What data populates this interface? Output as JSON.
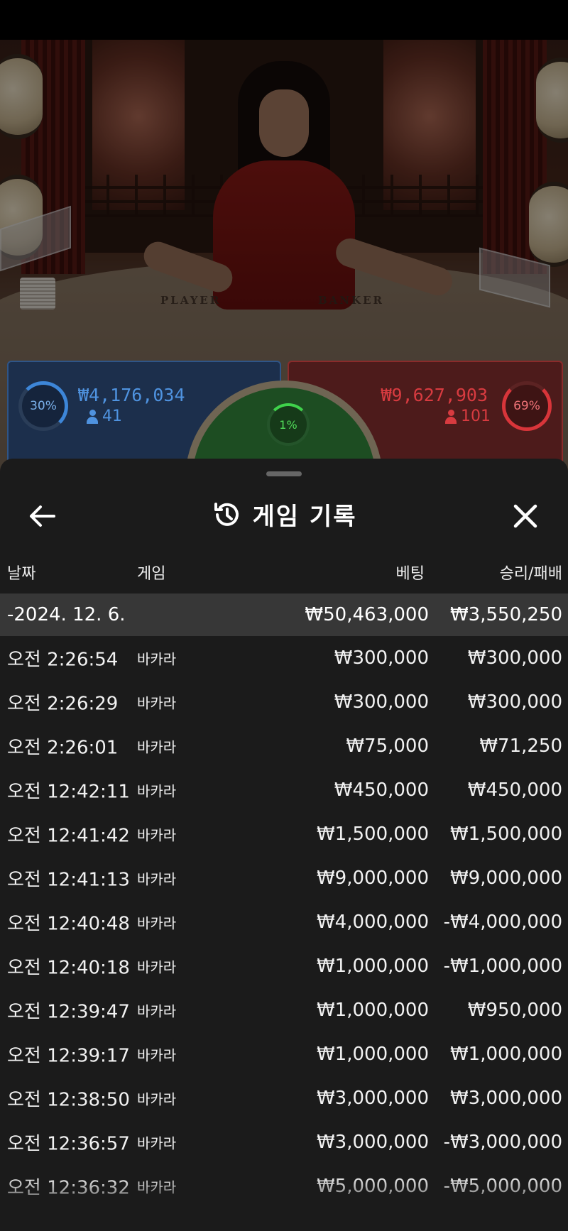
{
  "video": {
    "felt_player": "PLAYER",
    "felt_banker": "BANKER"
  },
  "bets": {
    "player": {
      "percent": "30%",
      "amount": "₩4,176,034",
      "players": "41",
      "ring_fill": 0.3,
      "color": "#3d86d8"
    },
    "banker": {
      "percent": "69%",
      "amount": "₩9,627,903",
      "players": "101",
      "ring_fill": 0.69,
      "color": "#d8353a"
    },
    "tie": {
      "percent": "1%",
      "ring_fill": 0.01,
      "color": "#3fd24b"
    }
  },
  "sheet": {
    "title": "게임 기록",
    "icons": {
      "back": "arrow-left-icon",
      "history": "history-clock-icon",
      "close": "close-icon"
    },
    "columns": {
      "date": "날짜",
      "game": "게임",
      "bet": "베팅",
      "win_loss": "승리/패배"
    },
    "summary": {
      "date": "-2024. 12. 6.",
      "bet": "₩50,463,000",
      "win_loss": "₩3,550,250"
    },
    "rows": [
      {
        "time": "오전 2:26:54",
        "game": "바카라",
        "bet": "₩300,000",
        "win_loss": "₩300,000"
      },
      {
        "time": "오전 2:26:29",
        "game": "바카라",
        "bet": "₩300,000",
        "win_loss": "₩300,000"
      },
      {
        "time": "오전 2:26:01",
        "game": "바카라",
        "bet": "₩75,000",
        "win_loss": "₩71,250"
      },
      {
        "time": "오전 12:42:11",
        "game": "바카라",
        "bet": "₩450,000",
        "win_loss": "₩450,000"
      },
      {
        "time": "오전 12:41:42",
        "game": "바카라",
        "bet": "₩1,500,000",
        "win_loss": "₩1,500,000"
      },
      {
        "time": "오전 12:41:13",
        "game": "바카라",
        "bet": "₩9,000,000",
        "win_loss": "₩9,000,000"
      },
      {
        "time": "오전 12:40:48",
        "game": "바카라",
        "bet": "₩4,000,000",
        "win_loss": "-₩4,000,000"
      },
      {
        "time": "오전 12:40:18",
        "game": "바카라",
        "bet": "₩1,000,000",
        "win_loss": "-₩1,000,000"
      },
      {
        "time": "오전 12:39:47",
        "game": "바카라",
        "bet": "₩1,000,000",
        "win_loss": "₩950,000"
      },
      {
        "time": "오전 12:39:17",
        "game": "바카라",
        "bet": "₩1,000,000",
        "win_loss": "₩1,000,000"
      },
      {
        "time": "오전 12:38:50",
        "game": "바카라",
        "bet": "₩3,000,000",
        "win_loss": "₩3,000,000"
      },
      {
        "time": "오전 12:36:57",
        "game": "바카라",
        "bet": "₩3,000,000",
        "win_loss": "-₩3,000,000"
      },
      {
        "time": "오전 12:36:32",
        "game": "바카라",
        "bet": "₩5,000,000",
        "win_loss": "-₩5,000,000"
      }
    ]
  }
}
